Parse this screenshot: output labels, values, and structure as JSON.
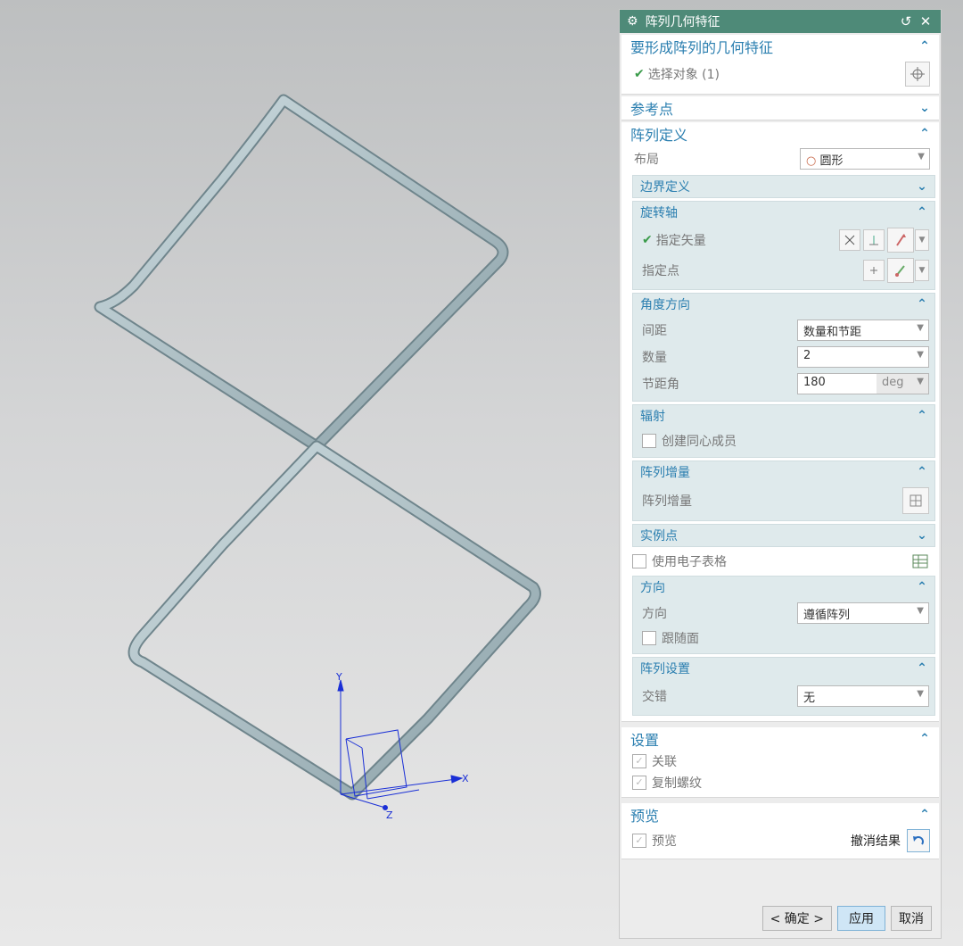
{
  "dialog": {
    "title": "阵列几何特征",
    "close_label": "✕",
    "reset_label": "↺"
  },
  "geometry_section": {
    "title": "要形成阵列的几何特征",
    "select_label": "选择对象 (1)"
  },
  "refpoint_section": {
    "title": "参考点"
  },
  "pattern_def": {
    "title": "阵列定义",
    "layout_label": "布局",
    "layout_value": "圆形",
    "boundary": {
      "title": "边界定义"
    },
    "rotation_axis": {
      "title": "旋转轴",
      "vector_label": "指定矢量",
      "point_label": "指定点"
    },
    "angular": {
      "title": "角度方向",
      "spacing_label": "间距",
      "spacing_value": "数量和节距",
      "count_label": "数量",
      "count_value": "2",
      "pitch_label": "节距角",
      "pitch_value": "180",
      "pitch_unit": "deg"
    },
    "radiate": {
      "title": "辐射",
      "concentric_label": "创建同心成员"
    },
    "increment": {
      "title": "阵列增量",
      "label": "阵列增量"
    },
    "instance_points": {
      "title": "实例点",
      "spreadsheet_label": "使用电子表格"
    },
    "orientation": {
      "title": "方向",
      "label": "方向",
      "value": "遵循阵列",
      "follow_face_label": "跟随面"
    },
    "settings": {
      "title": "阵列设置",
      "stagger_label": "交错",
      "stagger_value": "无"
    }
  },
  "settings_section": {
    "title": "设置",
    "associative_label": "关联",
    "copy_threads_label": "复制螺纹"
  },
  "preview_section": {
    "title": "预览",
    "preview_label": "预览",
    "undo_label": "撤消结果"
  },
  "buttons": {
    "ok": "< 确定 >",
    "apply": "应用",
    "cancel": "取消"
  },
  "axes": {
    "x": "X",
    "y": "Y",
    "z": "Z"
  },
  "colors": {
    "title_bar": "#4e8a78",
    "accent": "#2b7fb0",
    "tube": "#a9bcc2"
  }
}
